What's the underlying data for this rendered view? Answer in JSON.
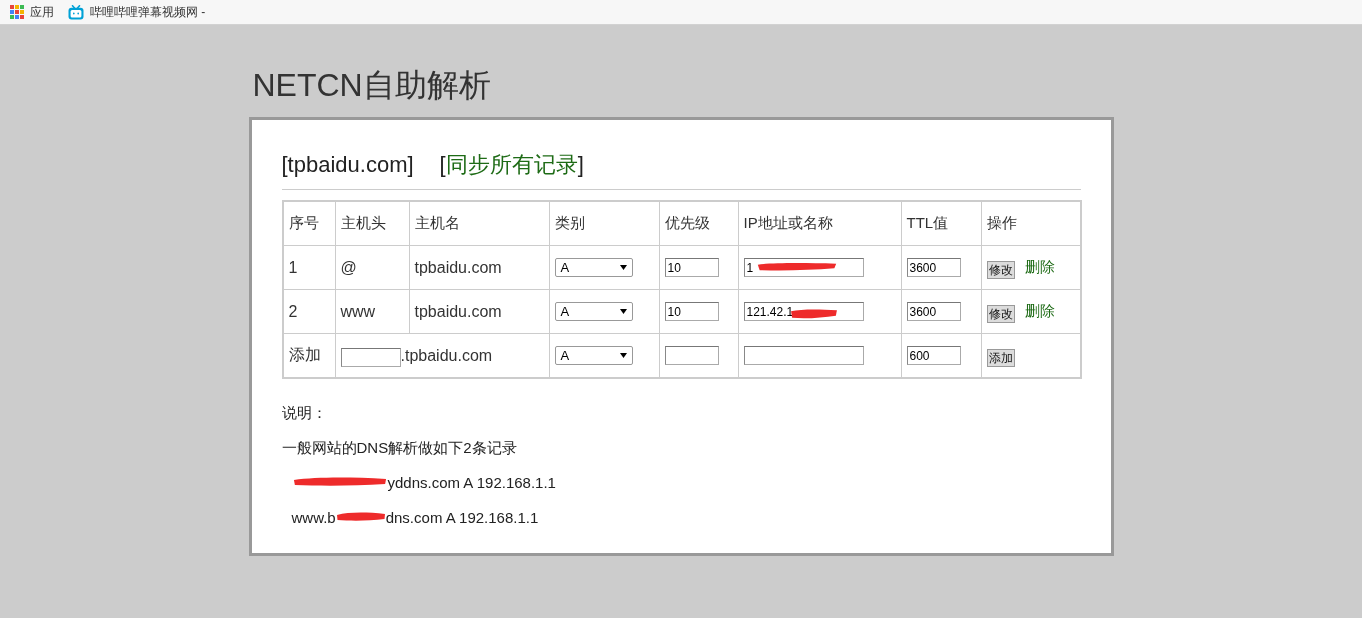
{
  "bookmarks_bar": {
    "items": [
      {
        "kind": "apps",
        "label": "应用"
      },
      {
        "kind": "site",
        "label": "哔哩哔哩弹幕视频网 -"
      }
    ]
  },
  "page_title": "NETCN自助解析",
  "panel": {
    "domain": "[tpbaidu.com]",
    "sync_link": {
      "open": "[",
      "label": "同步所有记录",
      "close": "]"
    }
  },
  "table": {
    "columns": [
      "序号",
      "主机头",
      "主机名",
      "类别",
      "优先级",
      "IP地址或名称",
      "TTL值",
      "操作"
    ],
    "rows": [
      {
        "kind": "record",
        "index": "1",
        "host": "@",
        "hostname": "tpbaidu.com",
        "type": "A",
        "priority": "10",
        "ip": "1",
        "redacted": true,
        "ttl": "3600",
        "edit_button": "修改",
        "delete_link": "删除"
      },
      {
        "kind": "record",
        "index": "2",
        "host": "www",
        "hostname": "tpbaidu.com",
        "type": "A",
        "priority": "10",
        "ip": "121.42.1",
        "redacted": true,
        "ttl": "3600",
        "edit_button": "修改",
        "delete_link": "删除"
      },
      {
        "kind": "add",
        "index": "添加",
        "suffix": ".tpbaidu.com",
        "type": "A",
        "ttl": "600",
        "add_button": "添加"
      }
    ]
  },
  "notes": {
    "heading": "说明：",
    "intro": "一般网站的DNS解析做如下2条记录",
    "examples": [
      {
        "after": "yddns.com A 192.168.1.1",
        "redacted": true
      },
      {
        "before": "www.b",
        "after": "dns.com A 192.168.1.1",
        "redacted": true
      }
    ]
  }
}
